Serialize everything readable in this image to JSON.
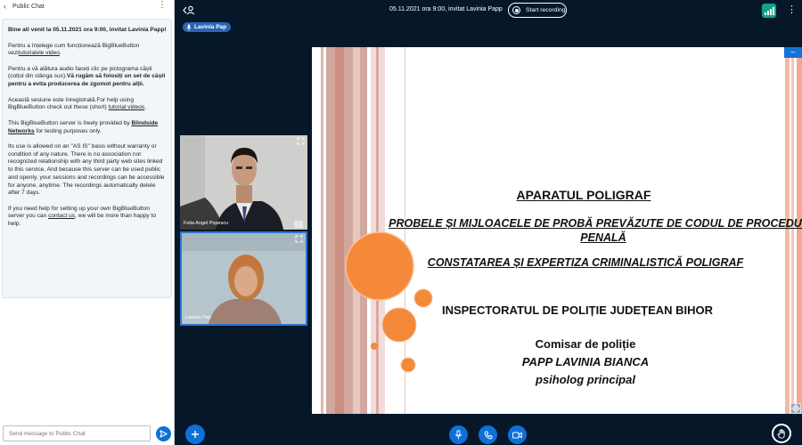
{
  "chat": {
    "title": "Public Chat",
    "messages": {
      "m1": "Bine ati venit la 05.11.2021 ora 9:00, invitat Lavinia Papp!",
      "m2a": "Pentru a înțelege cum funcționează BigBlueButton vezi",
      "m2link": "tutorialele video",
      "m2b": ".",
      "m3a": "Pentru a vă alătura audio faceți clic pe pictograma căști (colțul din stânga sus).",
      "m3b": "Vă rugăm să folosiți un set de căști pentru a evita producerea de zgomot pentru alții.",
      "m4a": "Această sesiune este înregistrată.For help using BigBlueButton check out these (short) ",
      "m4link": "tutorial videos",
      "m4b": ".",
      "m5a": "This BigBlueButton server is freely provided by ",
      "m5link": "Blindside Networks",
      "m5b": " for testing purposes only.",
      "m6": "Its use is allowed on an \"AS IS\" basis without warranty or condition of any nature. There is no association nor recognized relationship with any third party web sites linked to this service. And because this server can be used public and openly, your sessions and recordings can be accessible for anyone, anytime. The recordings automatically delete after 7 days.",
      "m7a": "If you need help for setting up your own BigBlueButton server you can ",
      "m7link": "contact us",
      "m7b": ", we will be more than happy to help."
    },
    "input_placeholder": "Send message to Public Chat"
  },
  "topbar": {
    "meeting_title": "05.11.2021 ora 9:00, invitat Lavinia Papp",
    "record_label": "Start recording"
  },
  "talker": {
    "name": "Lavinia Pap"
  },
  "webcams": [
    {
      "name": "Folia Angel Popescu"
    },
    {
      "name": "Lavinia Pap"
    }
  ],
  "slide": {
    "title": "APARATUL POLIGRAF",
    "line2": "PROBELE ȘI MIJLOACELE DE PROBĂ PREVĂZUTE DE CODUL DE PROCEDURĂ PENALĂ",
    "line3": "CONSTATAREA ȘI EXPERTIZA CRIMINALISTICĂ POLIGRAF",
    "line4": "INSPECTORATUL DE POLIȚIE JUDEȚEAN BIHOR",
    "line5": "Comisar de poliție",
    "line6": "PAPP LAVINIA BIANCA",
    "line7": "psiholog principal"
  },
  "colors": {
    "background": "#06172a",
    "accent": "#0f70d7",
    "slide_orange": "#f5893a",
    "connection": "#12a089"
  },
  "icons": {
    "back": "chevron-left-icon",
    "users": "user-toggle-icon",
    "record": "record-icon",
    "connection": "signal-bars-icon",
    "mic": "microphone-icon",
    "phone": "phone-icon",
    "camera": "video-camera-icon",
    "hand": "raise-hand-icon",
    "plus": "plus-icon",
    "send": "send-icon"
  }
}
